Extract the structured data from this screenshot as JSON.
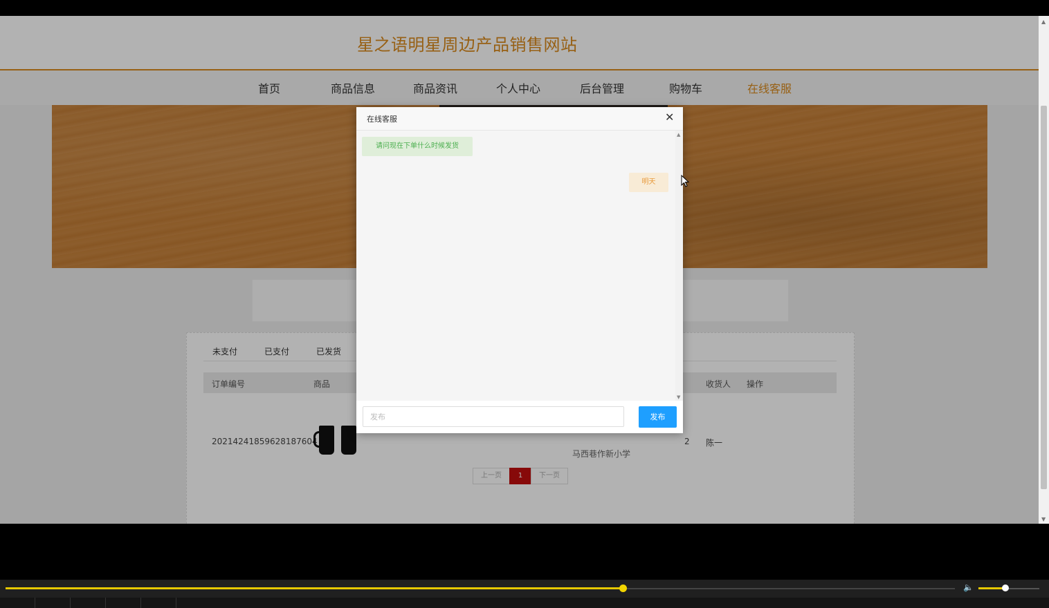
{
  "site": {
    "title": "星之语明星周边产品销售网站"
  },
  "nav": {
    "items": [
      "首页",
      "商品信息",
      "商品资讯",
      "个人中心",
      "后台管理",
      "购物车",
      "在线客服"
    ],
    "active_index": 6
  },
  "orders": {
    "tabs": [
      "未支付",
      "已支付",
      "已发货"
    ],
    "columns": [
      "订单编号",
      "商品",
      "收货人",
      "操作"
    ],
    "rows": [
      {
        "order_no": "20214241859628187604",
        "address_fragment": "马西巷作新小学",
        "phone_fragment": "2",
        "receiver": "陈一"
      }
    ],
    "pager": {
      "prev": "上一页",
      "current": "1",
      "next": "下一页"
    }
  },
  "chat_dialog": {
    "title": "在线客服",
    "close_icon": "close-icon",
    "messages": [
      {
        "side": "left",
        "text": "请问现在下单什么时候发货"
      },
      {
        "side": "right",
        "text": "明天"
      }
    ],
    "input_placeholder": "发布",
    "send_label": "发布"
  },
  "player": {
    "progress": 0.65,
    "volume": 0.4,
    "accent": "#e6c800"
  },
  "colors": {
    "brand": "#d98a1e",
    "send_button": "#1e9fff",
    "pager_current": "#c20e0e"
  }
}
